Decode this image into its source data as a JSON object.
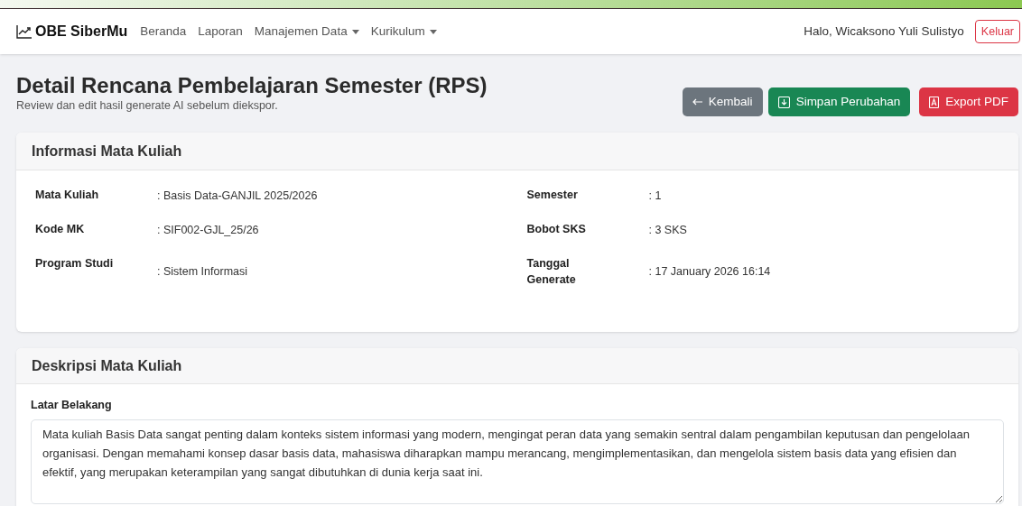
{
  "navbar": {
    "brand": "OBE SiberMu",
    "links": [
      {
        "label": "Beranda",
        "dropdown": false
      },
      {
        "label": "Laporan",
        "dropdown": false
      },
      {
        "label": "Manajemen Data",
        "dropdown": true
      },
      {
        "label": "Kurikulum",
        "dropdown": true
      }
    ],
    "greeting": "Halo, Wicaksono Yuli Sulistyo",
    "logout": "Keluar"
  },
  "page": {
    "title": "Detail Rencana Pembelajaran Semester (RPS)",
    "subtitle": "Review dan edit hasil generate AI sebelum diekspor.",
    "buttons": [
      {
        "kind": "back",
        "label": "Kembali"
      },
      {
        "kind": "save",
        "label": "Simpan Perubahan"
      },
      {
        "kind": "pdf",
        "label": "Export PDF"
      }
    ]
  },
  "info_card": {
    "title": "Informasi Mata Kuliah",
    "fields": [
      {
        "label": "Mata Kuliah",
        "value": ": Basis Data-GANJIL 2025/2026"
      },
      {
        "label": "Semester",
        "value": ": 1"
      },
      {
        "label": "Kode MK",
        "value": ": SIF002-GJL_25/26"
      },
      {
        "label": "Bobot SKS",
        "value": ": 3 SKS"
      },
      {
        "label": "Program Studi",
        "value": ": Sistem Informasi"
      },
      {
        "label": "Tanggal Generate",
        "value": ": 17 January 2026 16:14"
      }
    ]
  },
  "description_card": {
    "title": "Deskripsi Mata Kuliah",
    "field_label": "Latar Belakang",
    "value": "Mata kuliah Basis Data sangat penting dalam konteks sistem informasi yang modern, mengingat peran data yang semakin sentral dalam pengambilan keputusan dan pengelolaan organisasi. Dengan memahami konsep dasar basis data, mahasiswa diharapkan mampu merancang, mengimplementasikan, dan mengelola sistem basis data yang efisien dan efektif, yang merupakan keterampilan yang sangat dibutuhkan di dunia kerja saat ini."
  }
}
